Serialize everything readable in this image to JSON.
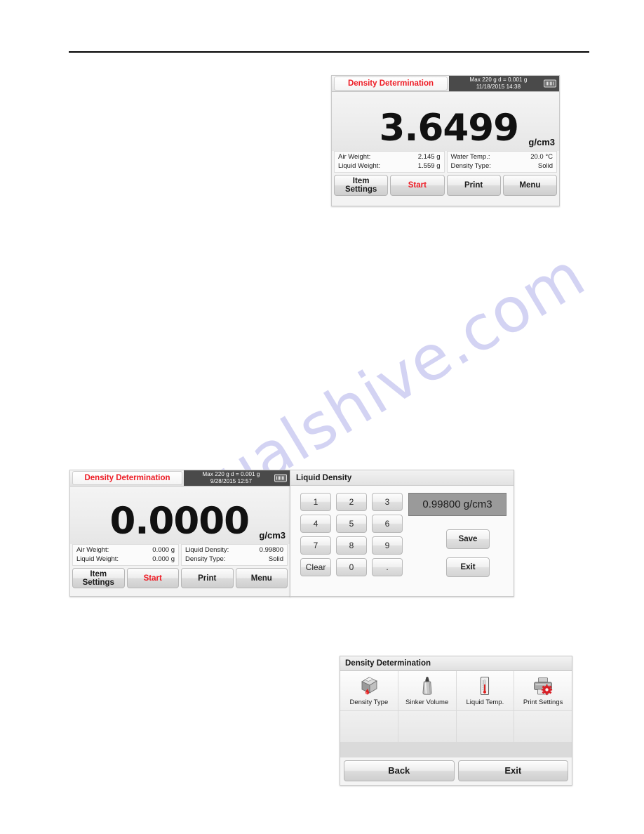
{
  "page": {
    "watermark": "manualshive.com"
  },
  "screen1": {
    "app_title": "Density Determination",
    "status_line1": "Max 220 g   d = 0.001 g",
    "status_line2": "11/18/2015  14:38",
    "connection_icon": "serial-port-icon",
    "readout_value": "3.6499",
    "readout_unit": "g/cm3",
    "info_left": [
      {
        "label": "Air Weight:",
        "value": "2.145 g"
      },
      {
        "label": "Liquid Weight:",
        "value": "1.559 g"
      }
    ],
    "info_right": [
      {
        "label": "Water Temp.:",
        "value": "20.0 °C"
      },
      {
        "label": "Density Type:",
        "value": "Solid"
      }
    ],
    "buttons": [
      {
        "label_line1": "Item",
        "label_line2": "Settings",
        "accent": false
      },
      {
        "label_line1": "Start",
        "label_line2": "",
        "accent": true
      },
      {
        "label_line1": "Print",
        "label_line2": "",
        "accent": false
      },
      {
        "label_line1": "Menu",
        "label_line2": "",
        "accent": false
      }
    ]
  },
  "screen2": {
    "app_title": "Density Determination",
    "status_line1": "Max 220 g   d = 0.001 g",
    "status_line2": "9/28/2015  12:57",
    "connection_icon": "serial-port-icon",
    "readout_value": "0.0000",
    "readout_unit": "g/cm3",
    "info_left": [
      {
        "label": "Air Weight:",
        "value": "0.000 g"
      },
      {
        "label": "Liquid Weight:",
        "value": "0.000 g"
      }
    ],
    "info_right": [
      {
        "label": "Liquid Density:",
        "value": "0.99800"
      },
      {
        "label": "Density Type:",
        "value": "Solid"
      }
    ],
    "buttons": [
      {
        "label_line1": "Item",
        "label_line2": "Settings",
        "accent": false
      },
      {
        "label_line1": "Start",
        "label_line2": "",
        "accent": true
      },
      {
        "label_line1": "Print",
        "label_line2": "",
        "accent": false
      },
      {
        "label_line1": "Menu",
        "label_line2": "",
        "accent": false
      }
    ]
  },
  "keypad_panel": {
    "title": "Liquid Density",
    "keys": [
      "1",
      "2",
      "3",
      "4",
      "5",
      "6",
      "7",
      "8",
      "9",
      "Clear",
      "0",
      "."
    ],
    "value": "0.99800 g/cm3",
    "save_label": "Save",
    "exit_label": "Exit"
  },
  "menu_panel": {
    "title": "Density Determination",
    "items": [
      {
        "label": "Density Type",
        "icon": "density-cube-icon"
      },
      {
        "label": "Sinker Volume",
        "icon": "sinker-bottle-icon"
      },
      {
        "label": "Liquid Temp.",
        "icon": "thermometer-icon"
      },
      {
        "label": "Print Settings",
        "icon": "printer-gear-icon"
      }
    ],
    "back_label": "Back",
    "exit_label": "Exit"
  }
}
